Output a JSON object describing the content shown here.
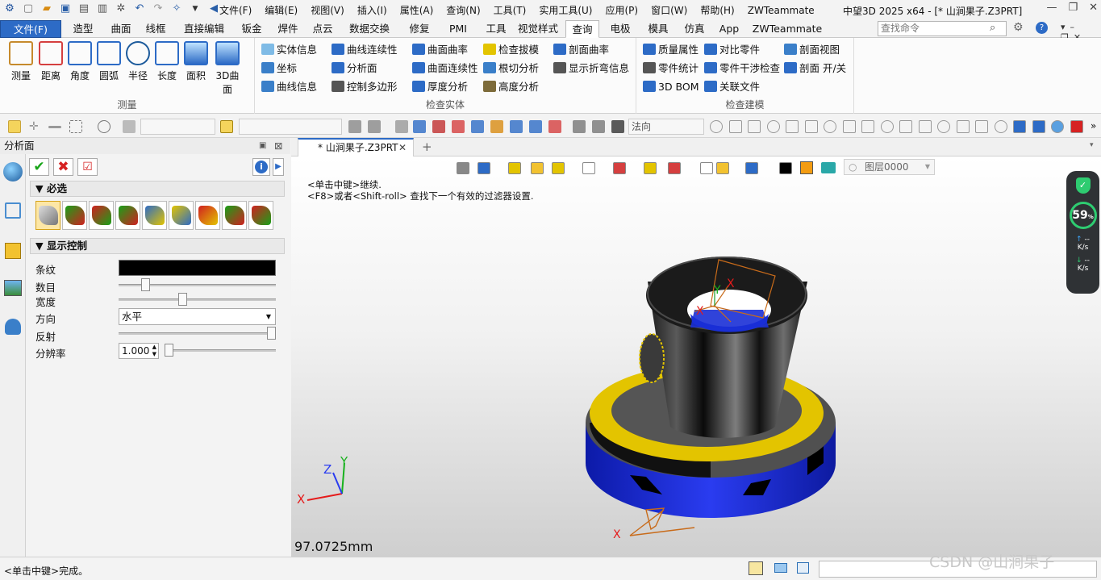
{
  "titlebar": {
    "menus": [
      "文件(F)",
      "编辑(E)",
      "视图(V)",
      "插入(I)",
      "属性(A)",
      "查询(N)",
      "工具(T)",
      "实用工具(U)",
      "应用(P)",
      "窗口(W)",
      "帮助(H)",
      "ZWTeammate"
    ],
    "window_title": "中望3D 2025 x64 - [* 山涧果子.Z3PRT]"
  },
  "tabs": [
    "文件(F)",
    "造型",
    "曲面",
    "线框",
    "直接编辑",
    "钣金",
    "焊件",
    "点云",
    "数据交换",
    "修复",
    "PMI",
    "工具",
    "视觉样式",
    "查询",
    "电极",
    "模具",
    "仿真",
    "App",
    "ZWTeammate"
  ],
  "active_tab": "查询",
  "search": {
    "placeholder": "查找命令"
  },
  "ribbon": {
    "measure": {
      "label": "测量",
      "buttons": [
        "测量",
        "距离",
        "角度",
        "圆弧",
        "半径",
        "长度",
        "面积",
        "3D曲面"
      ]
    },
    "check_entity": {
      "label": "检查实体",
      "items": [
        "实体信息",
        "坐标",
        "曲线信息",
        "曲线连续性",
        "分析面",
        "控制多边形",
        "曲面曲率",
        "曲面连续性",
        "厚度分析",
        "检查拔模",
        "根切分析",
        "高度分析",
        "剖面曲率",
        "显示折弯信息"
      ]
    },
    "check_model": {
      "label": "检查建模",
      "items": [
        "质量属性",
        "零件统计",
        "3D BOM",
        "对比零件",
        "零件干涉检查",
        "关联文件",
        "剖面视图",
        "剖面 开/关"
      ]
    }
  },
  "toolbar2": {
    "combo_direction": "法向"
  },
  "panel": {
    "title": "分析面",
    "required_section": "必选",
    "display_section": "显示控制",
    "rows": {
      "stripe": "条纹",
      "count": "数目",
      "width": "宽度",
      "direction": "方向",
      "direction_value": "水平",
      "reflect": "反射",
      "resolution": "分辨率",
      "resolution_value": "1.000"
    },
    "sliders": {
      "count": 0.15,
      "width": 0.4,
      "reflect": 1.0,
      "resolution": 0.0
    }
  },
  "document": {
    "tab": "* 山涧果子.Z3PRT"
  },
  "viewport": {
    "hint1": "<单击中键>继续.",
    "hint2": "<F8>或者<Shift-roll> 查找下一个有效的过滤器设置.",
    "layer": "图层0000",
    "measure_readout": "97.0725mm",
    "axes": {
      "x": "X",
      "y": "Y",
      "z": "Z"
    }
  },
  "network_widget": {
    "percent": "59",
    "percent_unit": "%",
    "up": "--",
    "up_unit": "K/s",
    "down": "--",
    "down_unit": "K/s"
  },
  "status": {
    "text": "<单击中键>完成。",
    "watermark": "CSDN @山涧果子"
  },
  "colors": {
    "accent": "#2d6bc6",
    "model_yellow": "#e3c400",
    "model_blue": "#1a2fd6",
    "model_gray": "#8a8a8a"
  }
}
